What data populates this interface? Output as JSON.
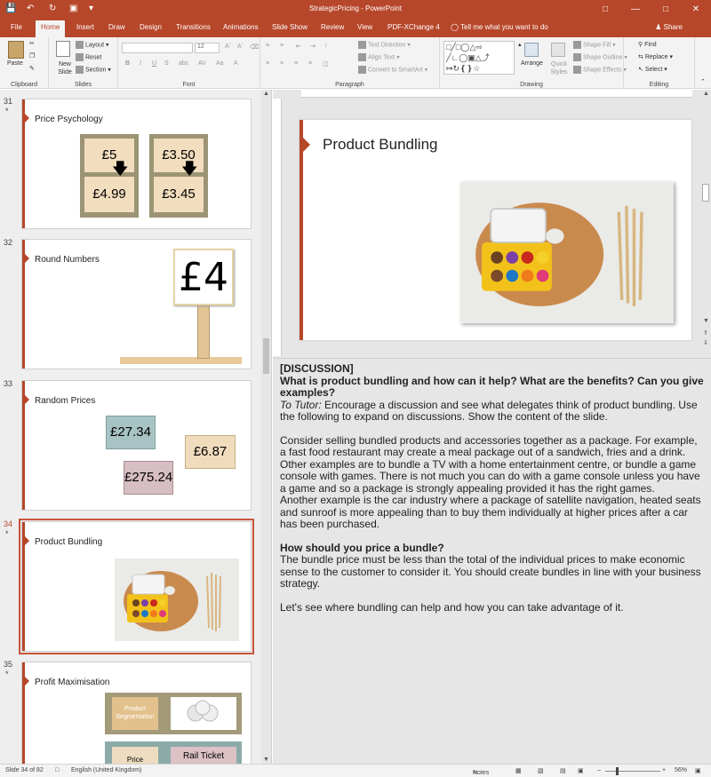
{
  "window": {
    "title": "StrategicPricing - PowerPoint"
  },
  "tabs": [
    "File",
    "Home",
    "Insert",
    "Draw",
    "Design",
    "Transitions",
    "Animations",
    "Slide Show",
    "Review",
    "View",
    "PDF-XChange 4"
  ],
  "tell_me": "Tell me what you want to do",
  "share": "Share",
  "ribbon": {
    "clipboard": {
      "label": "Clipboard",
      "paste": "Paste"
    },
    "slides": {
      "label": "Slides",
      "new_slide": "New Slide",
      "layout": "Layout",
      "reset": "Reset",
      "section": "Section"
    },
    "font": {
      "label": "Font",
      "size": "12"
    },
    "paragraph": {
      "label": "Paragraph",
      "text_direction": "Text Direction",
      "align_text": "Align Text",
      "convert_smartart": "Convert to SmartArt"
    },
    "drawing": {
      "label": "Drawing",
      "arrange": "Arrange",
      "quick_styles": "Quick Styles",
      "shape_fill": "Shape Fill",
      "shape_outline": "Shape Outline",
      "shape_effects": "Shape Effects"
    },
    "editing": {
      "label": "Editing",
      "find": "Find",
      "replace": "Replace",
      "select": "Select"
    }
  },
  "slides": [
    {
      "num": "31",
      "title": "Price Psychology",
      "prices": [
        "£5",
        "£4.99",
        "£3.50",
        "£3.45"
      ]
    },
    {
      "num": "32",
      "title": "Round Numbers",
      "sign": "£4"
    },
    {
      "num": "33",
      "title": "Random Prices",
      "prices": [
        "£27.34",
        "£6.87",
        "£275.24"
      ]
    },
    {
      "num": "34",
      "title": "Product Bundling"
    },
    {
      "num": "35",
      "title": "Profit Maximisation",
      "labels": [
        "Product Segmentation",
        "Price",
        "Rail Ticket"
      ]
    }
  ],
  "current_slide": {
    "title": "Product Bundling"
  },
  "notes": {
    "heading1": "[DISCUSSION]",
    "question1": "What is product bundling and how can it help? What are the benefits? Can you give examples?",
    "tutor_label": "To Tutor:",
    "tutor_text": " Encourage a discussion and see what delegates think of product bundling. Use the following to expand on discussions. Show the content of the slide.",
    "para1": "Consider selling bundled products and accessories together as a package. For example, a fast food restaurant may create a meal package out of a sandwich, fries and a drink.",
    "para2": "Other examples are to bundle a TV with a home entertainment centre, or bundle a game console with games. There is not much you can do with a game console unless you have a game and so a package is strongly appealing provided it has the right games.",
    "para3": "Another example is the car industry where a package of satellite navigation, heated seats and sunroof is more appealing than to buy them individually at higher prices after a car has been purchased.",
    "question2": "How should you price a bundle?",
    "para4": "The bundle price must be less than the total of the individual prices to make economic sense to the customer to consider it. You should create bundles in line with your business strategy.",
    "para5": "Let's see where bundling can help and how you can take advantage of it."
  },
  "status": {
    "slide_of": "Slide 34 of 82",
    "language": "English (United Kingdom)",
    "notes": "Notes",
    "zoom": "56%"
  }
}
